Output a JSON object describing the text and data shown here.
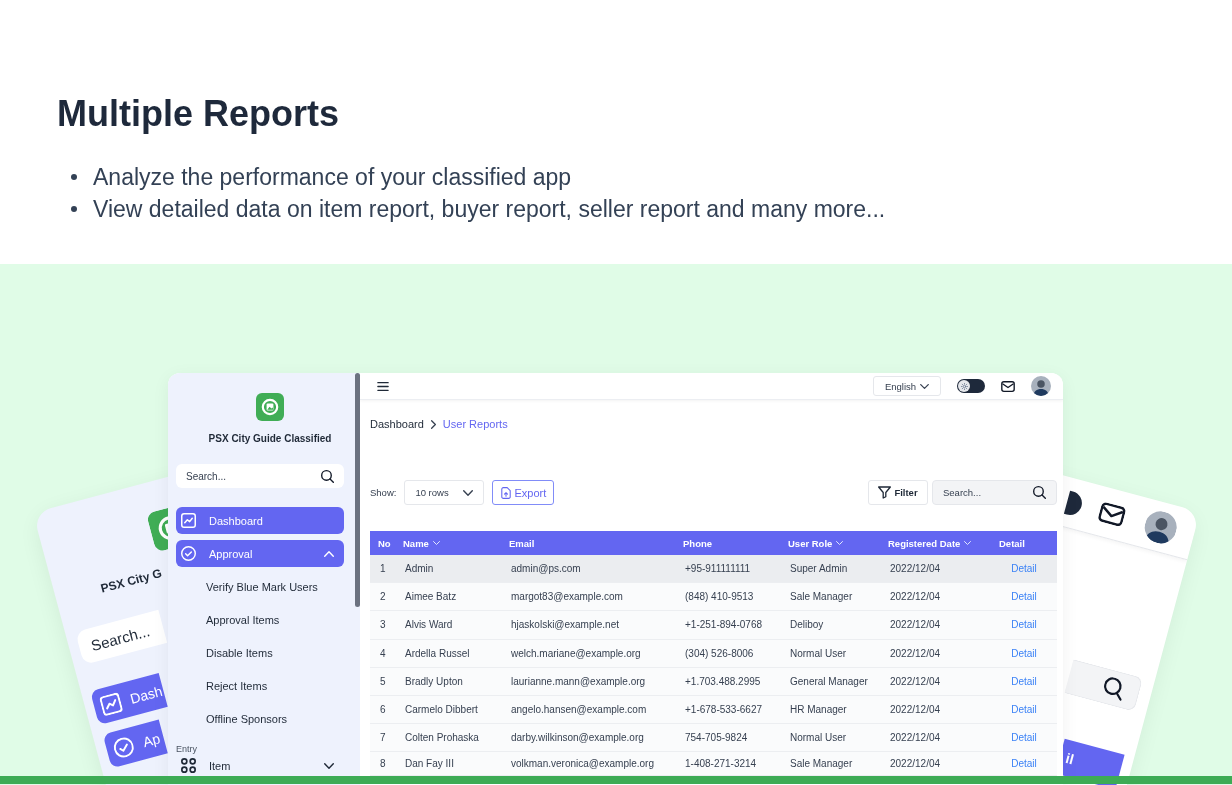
{
  "intro": {
    "title": "Multiple Reports",
    "bullets": [
      "Analyze the performance of your classified app",
      "View detailed data on item report, buyer report, seller report and many more..."
    ]
  },
  "left_preview": {
    "brand": "PSX City G",
    "search": {
      "placeholder": "Search..."
    },
    "items": [
      {
        "label": "Dash",
        "kind": "chart",
        "selected": true
      },
      {
        "label": "Ap",
        "kind": "check",
        "selected": true
      }
    ]
  },
  "right_preview": {
    "theme_toggle": {
      "on": false
    },
    "column_label": "il"
  },
  "sidebar": {
    "brand": "PSX City Guide Classified",
    "search": {
      "placeholder": "Search..."
    },
    "sections": [
      {
        "items": [
          {
            "label": "Dashboard",
            "kind": "chart",
            "selected": true
          },
          {
            "label": "Approval",
            "kind": "check",
            "selected": true,
            "expanded": true,
            "children": [
              {
                "label": "Verify Blue Mark Users",
                "selected": false
              },
              {
                "label": "Approval Items",
                "selected": false
              },
              {
                "label": "Disable Items",
                "selected": false
              },
              {
                "label": "Reject Items",
                "selected": false
              },
              {
                "label": "Offline Sponsors",
                "selected": false
              }
            ]
          }
        ]
      },
      {
        "heading": "Entry",
        "items": [
          {
            "label": "Item",
            "kind": "grid",
            "selected": false,
            "expanded": false
          }
        ]
      }
    ]
  },
  "topbar": {
    "language": "English",
    "theme_toggle": {
      "on": false
    }
  },
  "breadcrumb": [
    {
      "label": "Dashboard",
      "current": false
    },
    {
      "label": "User Reports",
      "current": true
    }
  ],
  "toolbar": {
    "show_label": "Show:",
    "rows_select": "10 rows",
    "export": "Export",
    "filter": "Filter",
    "search": {
      "placeholder": "Search..."
    }
  },
  "table": {
    "columns": [
      {
        "label": "No",
        "sortable": false
      },
      {
        "label": "Name",
        "sortable": true
      },
      {
        "label": "Email",
        "sortable": false
      },
      {
        "label": "Phone",
        "sortable": false
      },
      {
        "label": "User Role",
        "sortable": true
      },
      {
        "label": "Registered Date",
        "sortable": true
      },
      {
        "label": "Detail",
        "sortable": false
      }
    ],
    "rows": [
      {
        "cells": [
          "1",
          "Admin",
          "admin@ps.com",
          "+95-911111111",
          "Super Admin",
          "2022/12/04"
        ],
        "link": "Detail",
        "selected": true
      },
      {
        "cells": [
          "2",
          "Aimee Batz",
          "margot83@example.com",
          "(848) 410-9513",
          "Sale Manager",
          "2022/12/04"
        ],
        "link": "Detail",
        "selected": false
      },
      {
        "cells": [
          "3",
          "Alvis Ward",
          "hjaskolski@example.net",
          "+1-251-894-0768",
          "Deliboy",
          "2022/12/04"
        ],
        "link": "Detail",
        "selected": false
      },
      {
        "cells": [
          "4",
          "Ardella Russel",
          "welch.mariane@example.org",
          "(304) 526-8006",
          "Normal User",
          "2022/12/04"
        ],
        "link": "Detail",
        "selected": false
      },
      {
        "cells": [
          "5",
          "Bradly Upton",
          "laurianne.mann@example.org",
          "+1.703.488.2995",
          "General Manager",
          "2022/12/04"
        ],
        "link": "Detail",
        "selected": false
      },
      {
        "cells": [
          "6",
          "Carmelo Dibbert",
          "angelo.hansen@example.com",
          "+1-678-533-6627",
          "HR Manager",
          "2022/12/04"
        ],
        "link": "Detail",
        "selected": false
      },
      {
        "cells": [
          "7",
          "Colten Prohaska",
          "darby.wilkinson@example.org",
          "754-705-9824",
          "Normal User",
          "2022/12/04"
        ],
        "link": "Detail",
        "selected": false
      },
      {
        "cells": [
          "8",
          "Dan Fay III",
          "volkman.veronica@example.org",
          "1-408-271-3214",
          "Sale Manager",
          "2022/12/04"
        ],
        "link": "Detail",
        "selected": false
      }
    ]
  }
}
